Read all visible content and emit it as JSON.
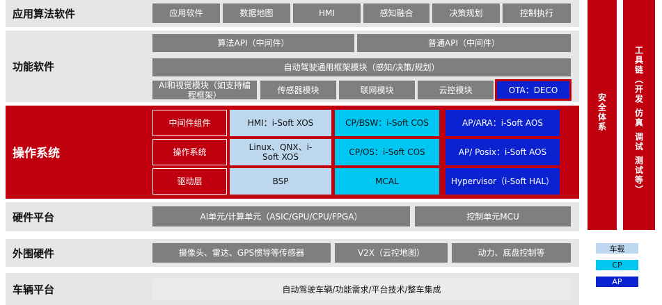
{
  "rows": {
    "app_software": {
      "label": "应用算法软件",
      "items": [
        "应用软件",
        "数据地图",
        "HMI",
        "感知融合",
        "决策规划",
        "控制执行"
      ]
    },
    "function_software": {
      "label": "功能软件",
      "api_algo": "算法API（中间件）",
      "api_normal": "普通API（中间件）",
      "framework": "自动驾驶通用框架模块（感知/决策/规划）",
      "modules": [
        "AI和视觉模块（如支持编程框架）",
        "传感器模块",
        "联网模块",
        "云控模块"
      ],
      "ota": "OTA：DECO"
    },
    "os": {
      "label": "操作系统",
      "layers": [
        {
          "name": "中间件组件",
          "light": "HMI：i-Soft XOS",
          "cp": "CP/BSW：i-Soft COS",
          "ap": "AP/ARA：i-Soft AOS"
        },
        {
          "name": "操作系统",
          "light": "Linux、QNX、i-Soft XOS",
          "cp": "CP/OS：i-Soft COS",
          "ap": "AP/ Posix：i-Soft AOS"
        },
        {
          "name": "驱动层",
          "light": "BSP",
          "cp": "MCAL",
          "ap": "Hypervisor（i-Soft HAL）"
        }
      ]
    },
    "hardware": {
      "label": "硬件平台",
      "ai_unit": "AI单元/计算单元（ASIC/GPU/CPU/FPGA）",
      "mcu": "控制单元MCU"
    },
    "peripheral": {
      "label": "外围硬件",
      "items": [
        "摄像头、雷达、GPS惯导等传感器",
        "V2X（云控地图）",
        "动力、底盘控制等"
      ]
    },
    "vehicle": {
      "label": "车辆平台",
      "item": "自动驾驶车辆/功能需求/平台技术/整车集成"
    }
  },
  "side": {
    "safety": "安全体系",
    "toolchain": "工具链（开发 仿真 调试 测试等）"
  },
  "legend": {
    "vehicle_label": "车载",
    "cp_label": "CP",
    "ap_label": "AP",
    "colors": {
      "vehicle": "#bcd7ee",
      "cp": "#00c6f2",
      "ap": "#0a22d0"
    }
  }
}
